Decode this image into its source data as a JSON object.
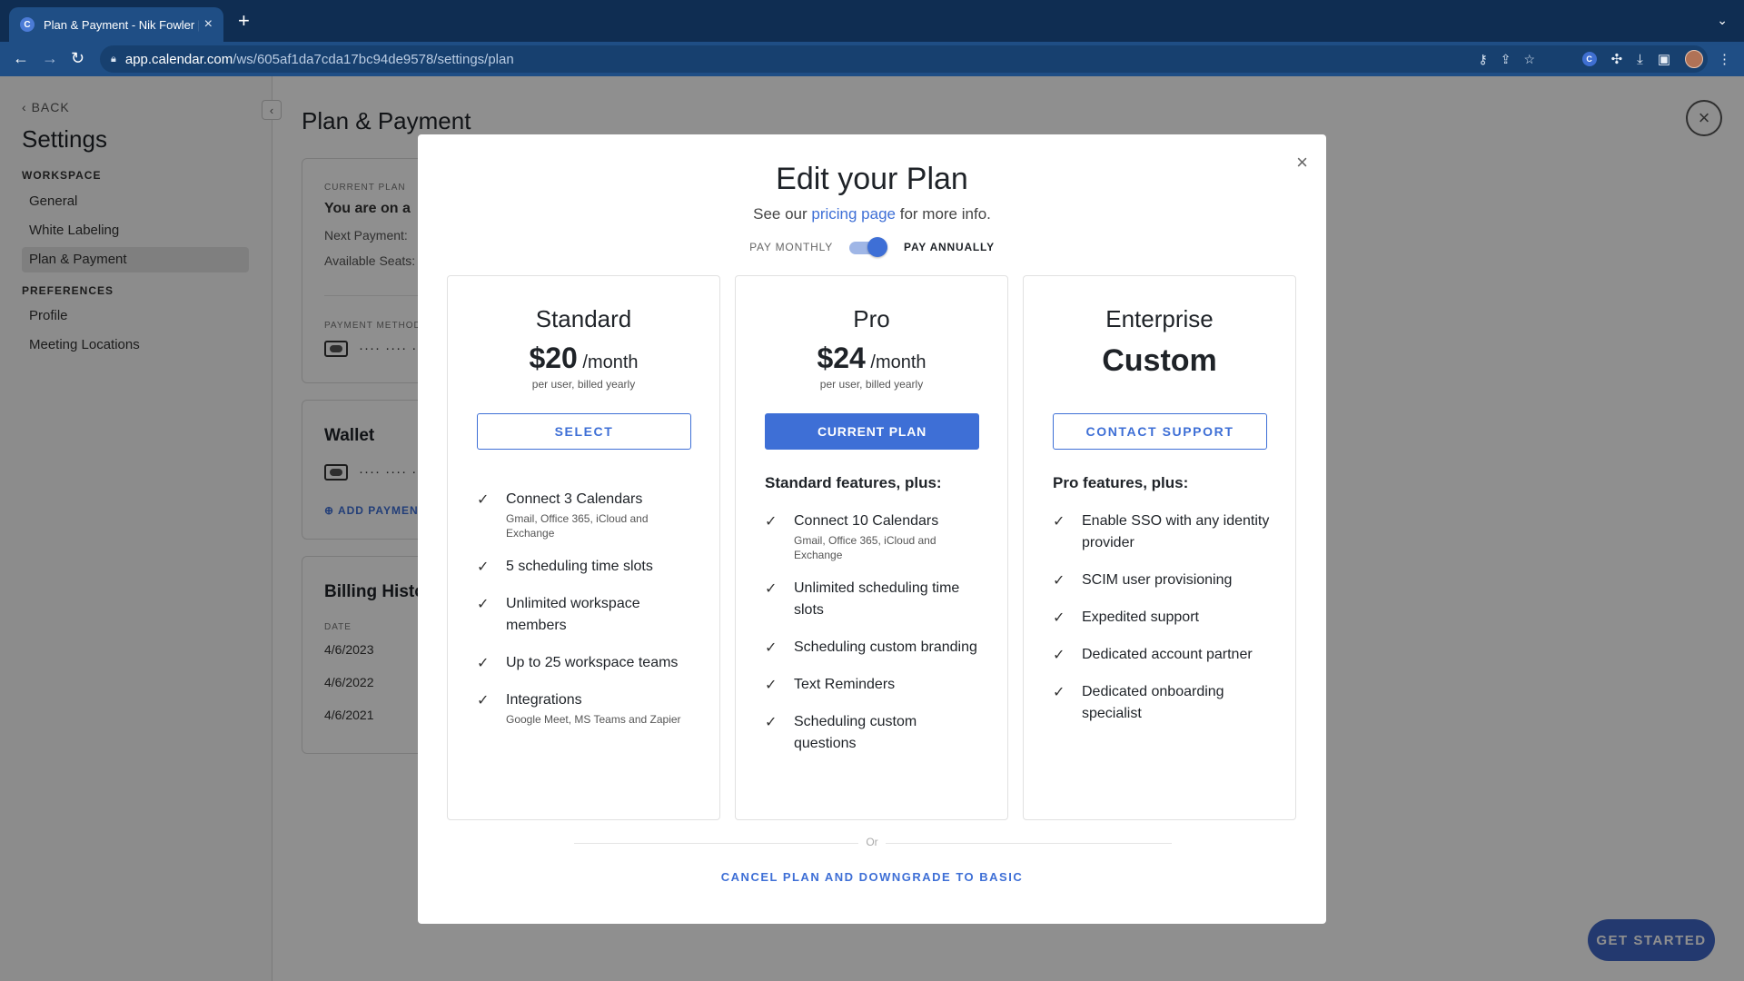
{
  "browser": {
    "tab_title": "Plan & Payment - Nik Fowler | C",
    "tab_icon_letter": "C",
    "url_host": "app.calendar.com",
    "url_path": "/ws/605af1da7cda17bc94de9578/settings/plan",
    "extension_letter": "C"
  },
  "sidebar": {
    "back_label": "BACK",
    "title": "Settings",
    "workspace_heading": "WORKSPACE",
    "workspace_items": [
      {
        "label": "General"
      },
      {
        "label": "White Labeling"
      },
      {
        "label": "Plan & Payment",
        "active": true
      }
    ],
    "preferences_heading": "PREFERENCES",
    "preferences_items": [
      {
        "label": "Profile"
      },
      {
        "label": "Meeting Locations"
      }
    ]
  },
  "main": {
    "title": "Plan & Payment",
    "current_plan": {
      "label": "CURRENT PLAN",
      "headline": "You are on a",
      "next_payment_label": "Next Payment:",
      "available_seats_label": "Available Seats:",
      "payment_method_label": "PAYMENT METHOD",
      "card_dots": "···· ···· ····"
    },
    "wallet": {
      "title": "Wallet",
      "card_dots": "···· ···· ····",
      "add_payment_label": "ADD PAYMENT"
    },
    "billing_history": {
      "title": "Billing Histo",
      "date_header": "DATE",
      "dates": [
        "4/6/2023",
        "4/6/2022",
        "4/6/2021"
      ]
    },
    "get_started_label": "GET STARTED"
  },
  "modal": {
    "title": "Edit your Plan",
    "subtitle_prefix": "See our ",
    "subtitle_link": "pricing page",
    "subtitle_suffix": " for more info.",
    "billing_monthly": "PAY MONTHLY",
    "billing_annually": "PAY ANNUALLY",
    "billing_annual_selected": true,
    "plans": [
      {
        "name": "Standard",
        "price": "$20",
        "period": " /month",
        "note": "per user, billed yearly",
        "button": "SELECT",
        "features_heading": "",
        "features": [
          {
            "text": "Connect 3 Calendars",
            "sub": "Gmail, Office 365, iCloud and Exchange"
          },
          {
            "text": "5 scheduling time slots",
            "sub": ""
          },
          {
            "text": "Unlimited workspace members",
            "sub": ""
          },
          {
            "text": "Up to 25 workspace teams",
            "sub": ""
          },
          {
            "text": "Integrations",
            "sub": "Google Meet, MS Teams and Zapier"
          }
        ]
      },
      {
        "name": "Pro",
        "price": "$24",
        "period": " /month",
        "note": "per user, billed yearly",
        "button": "CURRENT PLAN",
        "features_heading": "Standard features, plus:",
        "features": [
          {
            "text": "Connect 10 Calendars",
            "sub": "Gmail, Office 365, iCloud and Exchange"
          },
          {
            "text": "Unlimited scheduling time slots",
            "sub": ""
          },
          {
            "text": "Scheduling custom branding",
            "sub": ""
          },
          {
            "text": "Text Reminders",
            "sub": ""
          },
          {
            "text": "Scheduling custom questions",
            "sub": ""
          }
        ]
      },
      {
        "name": "Enterprise",
        "price": "Custom",
        "button": "CONTACT SUPPORT",
        "features_heading": "Pro features, plus:",
        "features": [
          {
            "text": "Enable SSO with any identity provider",
            "sub": ""
          },
          {
            "text": "SCIM user provisioning",
            "sub": ""
          },
          {
            "text": "Expedited support",
            "sub": ""
          },
          {
            "text": "Dedicated account partner",
            "sub": ""
          },
          {
            "text": "Dedicated onboarding specialist",
            "sub": ""
          }
        ]
      }
    ],
    "or_label": "Or",
    "cancel_label": "CANCEL PLAN AND DOWNGRADE TO BASIC"
  },
  "colors": {
    "accent": "#3e6fd6",
    "chrome_dark": "#0f2d52",
    "chrome_toolbar": "#1f4e85"
  }
}
